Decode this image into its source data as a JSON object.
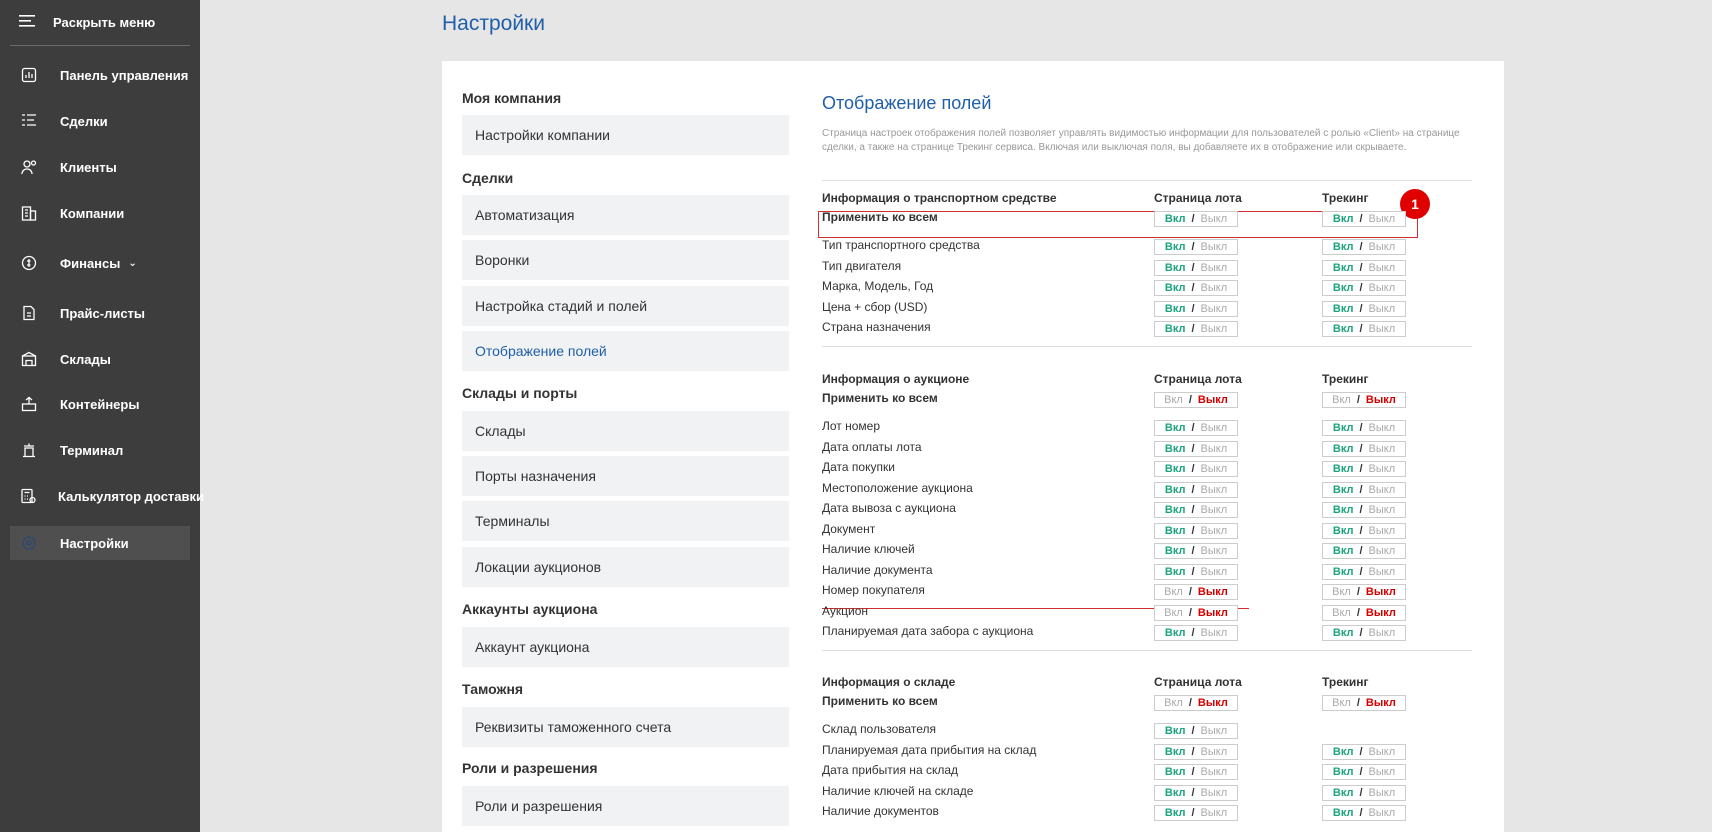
{
  "sidebar": {
    "toggle_label": "Раскрыть меню",
    "items": [
      {
        "label": "Панель управления",
        "icon": "dashboard-icon"
      },
      {
        "label": "Сделки",
        "icon": "deals-list-icon"
      },
      {
        "label": "Клиенты",
        "icon": "clients-icon"
      },
      {
        "label": "Компании",
        "icon": "companies-icon"
      },
      {
        "label": "Финансы",
        "icon": "finance-icon"
      },
      {
        "label": "Прайс-листы",
        "icon": "price-list-icon"
      },
      {
        "label": "Склады",
        "icon": "warehouse-icon"
      },
      {
        "label": "Контейнеры",
        "icon": "containers-icon"
      },
      {
        "label": "Терминал",
        "icon": "terminal-icon"
      },
      {
        "label": "Калькулятор доставки",
        "icon": "calculator-icon"
      },
      {
        "label": "Настройки",
        "icon": "settings-icon"
      }
    ]
  },
  "page_title": "Настройки",
  "settings_nav": {
    "groups": [
      {
        "title": "Моя компания",
        "items": [
          "Настройки компании"
        ]
      },
      {
        "title": "Сделки",
        "items": [
          "Автоматизация",
          "Воронки",
          "Настройка стадий и полей",
          "Отображение полей"
        ]
      },
      {
        "title": "Склады и порты",
        "items": [
          "Склады",
          "Порты назначения",
          "Терминалы",
          "Локации аукционов"
        ]
      },
      {
        "title": "Аккаунты аукциона",
        "items": [
          "Аккаунт аукциона"
        ]
      },
      {
        "title": "Таможня",
        "items": [
          "Реквизиты таможенного счета"
        ]
      },
      {
        "title": "Роли и разрешения",
        "items": [
          "Роли и разрешения"
        ]
      }
    ],
    "active_item": "Отображение полей"
  },
  "section": {
    "title": "Отображение полей",
    "description": "Страница настроек отображения полей позволяет управлять видимостью информации для пользователей с ролью «Client» на странице сделки, а также на странице Трекинг сервиса. Включая или выключая поля, вы добавляете их в отображение или скрываете."
  },
  "toggle_labels": {
    "on": "Вкл",
    "sep": "/",
    "off": "Выкл"
  },
  "columns": {
    "lot_page": "Страница лота",
    "tracking": "Трекинг"
  },
  "groups": [
    {
      "title": "Информация о транспортном средстве",
      "apply_all": {
        "label": "Применить ко всем",
        "lot": "on",
        "tracking": "on"
      },
      "rows": [
        {
          "label": "Тип транспортного средства",
          "lot": "on",
          "tracking": "on"
        },
        {
          "label": "Тип двигателя",
          "lot": "on",
          "tracking": "on"
        },
        {
          "label": "Марка, Модель, Год",
          "lot": "on",
          "tracking": "on"
        },
        {
          "label": "Цена + сбор (USD)",
          "lot": "on",
          "tracking": "on"
        },
        {
          "label": "Страна назначения",
          "lot": "on",
          "tracking": "on"
        }
      ]
    },
    {
      "title": "Информация о аукционе",
      "apply_all": {
        "label": "Применить ко всем",
        "lot": "off",
        "tracking": "off"
      },
      "rows": [
        {
          "label": "Лот номер",
          "lot": "on",
          "tracking": "on"
        },
        {
          "label": "Дата оплаты лота",
          "lot": "on",
          "tracking": "on"
        },
        {
          "label": "Дата покупки",
          "lot": "on",
          "tracking": "on"
        },
        {
          "label": "Местоположение аукциона",
          "lot": "on",
          "tracking": "on"
        },
        {
          "label": "Дата вывоза с аукциона",
          "lot": "on",
          "tracking": "on"
        },
        {
          "label": "Документ",
          "lot": "on",
          "tracking": "on"
        },
        {
          "label": "Наличие ключей",
          "lot": "on",
          "tracking": "on"
        },
        {
          "label": "Наличие документа",
          "lot": "on",
          "tracking": "on"
        },
        {
          "label": "Номер покупателя",
          "lot": "off",
          "tracking": "off"
        },
        {
          "label": "Аукцион",
          "lot": "off",
          "tracking": "off"
        },
        {
          "label": "Планируемая дата забора с аукциона",
          "lot": "on",
          "tracking": "on"
        }
      ]
    },
    {
      "title": "Информация о складе",
      "apply_all": {
        "label": "Применить ко всем",
        "lot": "off",
        "tracking": "off"
      },
      "rows": [
        {
          "label": "Склад пользователя",
          "lot": "on",
          "tracking": null
        },
        {
          "label": "Планируемая дата прибытия на склад",
          "lot": "on",
          "tracking": "on"
        },
        {
          "label": "Дата прибытия на склад",
          "lot": "on",
          "tracking": "on"
        },
        {
          "label": "Наличие ключей на складе",
          "lot": "on",
          "tracking": "on"
        },
        {
          "label": "Наличие документов",
          "lot": "on",
          "tracking": "on"
        }
      ]
    }
  ],
  "annotation": {
    "badge": "1"
  },
  "colors": {
    "accent": "#1f5fa8",
    "on": "#1ba37e",
    "off": "#d40000",
    "sidebar": "#3d3d3d"
  }
}
